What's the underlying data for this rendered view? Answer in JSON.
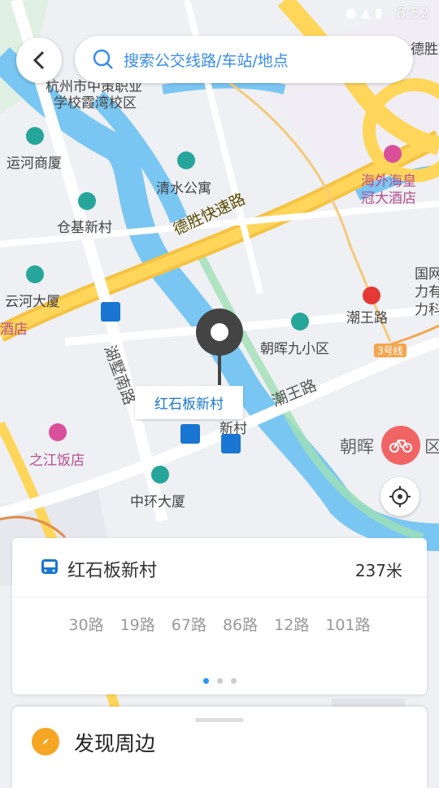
{
  "status": {
    "time": "8:52"
  },
  "search": {
    "placeholder": "搜索公交线路/车站/地点"
  },
  "map": {
    "labels": {
      "school": "杭州市中策职业",
      "school2": "学校霞湾校区",
      "yunhe": "运河商厦",
      "qingshui": "清水公寓",
      "cangji": "仓基新村",
      "yunhe_dasha": "云河大厦",
      "jiudian": "酒店",
      "hotel_top": "海外海皇",
      "hotel_top2": "冠大酒店",
      "chaowang_station": "潮王路",
      "chaohui9": "朝晖九小区",
      "zhijiang": "之江饭店",
      "zhonghuan": "中环大厦",
      "chaohui_xq": "朝晖",
      "xiaoqu": "区",
      "guowang": "国网",
      "guowang2": "力有",
      "guowang3": "力科",
      "de": "德胜",
      "xincun": "新村",
      "line3": "3号线"
    },
    "roads": {
      "desheng": "德胜快速路",
      "chaowang": "潮王路",
      "hushu": "湖墅南路"
    },
    "pin_label": "红石板新村"
  },
  "card": {
    "stop_name": "红石板新村",
    "distance": "237米",
    "routes": [
      "30路",
      "19路",
      "67路",
      "86路",
      "12路",
      "101路"
    ],
    "page": 1,
    "pages": 3
  },
  "discover": {
    "title": "发现周边"
  }
}
